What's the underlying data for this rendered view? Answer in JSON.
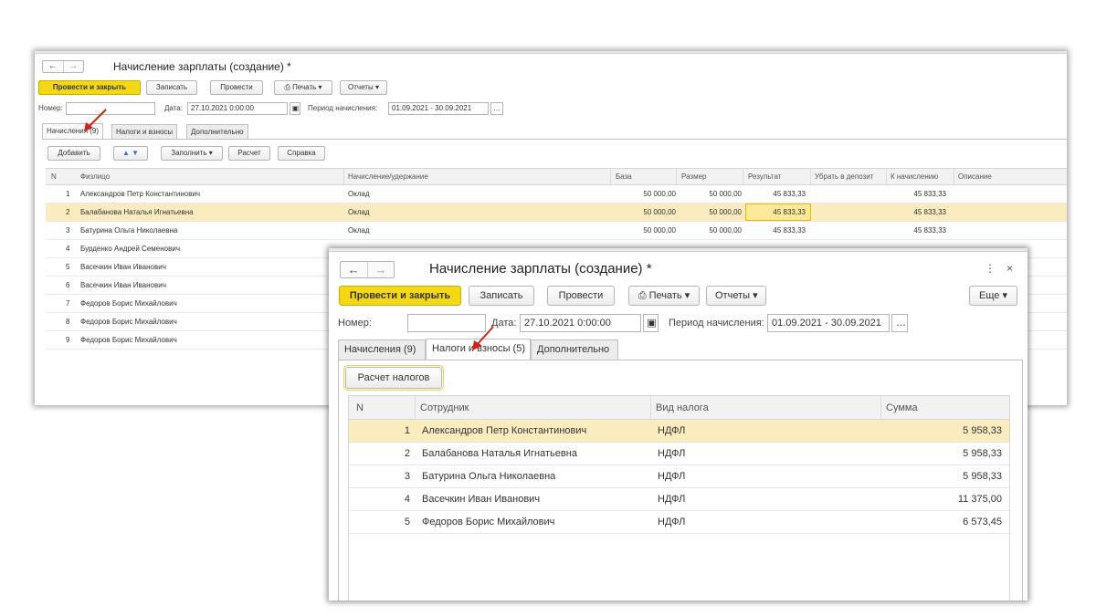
{
  "back": {
    "title": "Начисление зарплаты (создание) *",
    "toolbar": {
      "post_close": "Провести и закрыть",
      "save": "Записать",
      "post": "Провести",
      "print": "Печать",
      "reports": "Отчеты"
    },
    "number_label": "Номер:",
    "date_label": "Дата:",
    "date_value": "27.10.2021  0:00:00",
    "period_label": "Период начисления:",
    "period_value": "01.09.2021 - 30.09.2021",
    "tabs": [
      "Начисления (9)",
      "Налоги и взносы",
      "Дополнительно"
    ],
    "tab_toolbar": {
      "add": "Добавить",
      "fill": "Заполнить",
      "calc": "Расчет",
      "help": "Справка"
    },
    "columns": [
      "N",
      "Физлицо",
      "Начисление/удержание",
      "База",
      "Размер",
      "Результат",
      "Убрать в депозит",
      "К начислению",
      "Описание"
    ],
    "rows": [
      {
        "n": "1",
        "name": "Александров Петр Константинович",
        "type": "Оклад",
        "base": "50 000,00",
        "size": "50 000,00",
        "result": "45 833,33",
        "accrue": "45 833,33"
      },
      {
        "n": "2",
        "name": "Балабанова Наталья Игнатьевна",
        "type": "Оклад",
        "base": "50 000,00",
        "size": "50 000,00",
        "result": "45 833,33",
        "accrue": "45 833,33"
      },
      {
        "n": "3",
        "name": "Батурина Ольга Николаевна",
        "type": "Оклад",
        "base": "50 000,00",
        "size": "50 000,00",
        "result": "45 833,33",
        "accrue": "45 833,33"
      },
      {
        "n": "4",
        "name": "Бурденко Андрей Семенович"
      },
      {
        "n": "5",
        "name": "Васечкин Иван Иванович"
      },
      {
        "n": "6",
        "name": "Васечкин Иван Иванович"
      },
      {
        "n": "7",
        "name": "Федоров Борис Михайлович"
      },
      {
        "n": "8",
        "name": "Федоров Борис Михайлович"
      },
      {
        "n": "9",
        "name": "Федоров Борис Михайлович"
      }
    ]
  },
  "front": {
    "title": "Начисление зарплаты (создание) *",
    "toolbar": {
      "post_close": "Провести и закрыть",
      "save": "Записать",
      "post": "Провести",
      "print": "Печать",
      "reports": "Отчеты",
      "more": "Еще"
    },
    "number_label": "Номер:",
    "date_label": "Дата:",
    "date_value": "27.10.2021  0:00:00",
    "period_label": "Период начисления:",
    "period_value": "01.09.2021 - 30.09.2021",
    "tabs": [
      "Начисления (9)",
      "Налоги и взносы (5)",
      "Дополнительно"
    ],
    "calc_taxes": "Расчет налогов",
    "columns": [
      "N",
      "Сотрудник",
      "Вид налога",
      "Сумма"
    ],
    "rows": [
      {
        "n": "1",
        "name": "Александров Петр Константинович",
        "tax": "НДФЛ",
        "sum": "5 958,33"
      },
      {
        "n": "2",
        "name": "Балабанова Наталья Игнатьевна",
        "tax": "НДФЛ",
        "sum": "5 958,33"
      },
      {
        "n": "3",
        "name": "Батурина Ольга Николаевна",
        "tax": "НДФЛ",
        "sum": "5 958,33"
      },
      {
        "n": "4",
        "name": "Васечкин Иван Иванович",
        "tax": "НДФЛ",
        "sum": "11 375,00"
      },
      {
        "n": "5",
        "name": "Федоров Борис Михайлович",
        "tax": "НДФЛ",
        "sum": "6 573,45"
      }
    ]
  }
}
